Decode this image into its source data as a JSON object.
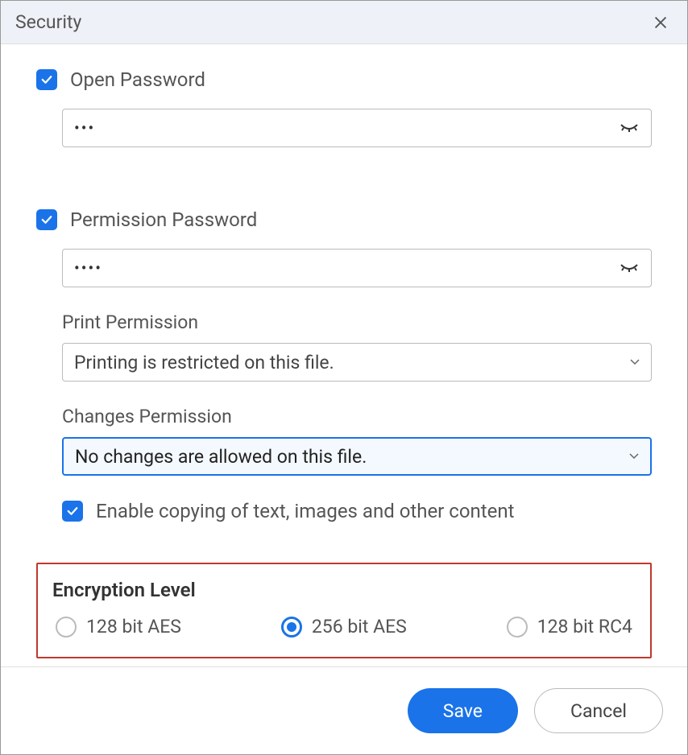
{
  "title": "Security",
  "open_password": {
    "label": "Open Password",
    "checked": true,
    "value": "•••"
  },
  "permission_password": {
    "label": "Permission Password",
    "checked": true,
    "value": "••••"
  },
  "print_permission": {
    "label": "Print Permission",
    "selected": "Printing is restricted on this file."
  },
  "changes_permission": {
    "label": "Changes Permission",
    "selected": "No changes are allowed on this file."
  },
  "enable_copy": {
    "checked": true,
    "label": "Enable copying of text, images and other content"
  },
  "encryption": {
    "title": "Encryption Level",
    "options": [
      {
        "label": "128 bit AES",
        "selected": false
      },
      {
        "label": "256 bit AES",
        "selected": true
      },
      {
        "label": "128 bit RC4",
        "selected": false
      }
    ]
  },
  "buttons": {
    "save": "Save",
    "cancel": "Cancel"
  }
}
